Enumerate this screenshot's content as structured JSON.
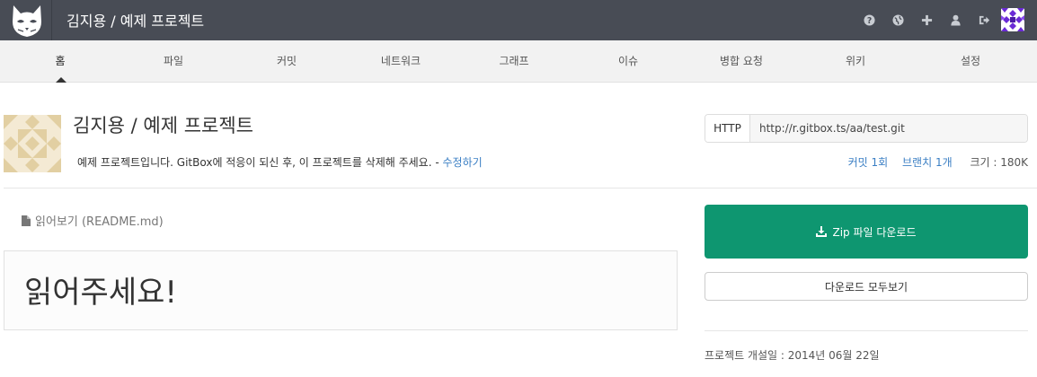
{
  "header": {
    "title": "김지용 / 예제 프로젝트",
    "logo_icon": "cat-logo-icon",
    "icons": [
      "help-icon",
      "globe-icon",
      "plus-icon",
      "user-icon",
      "sign-out-icon"
    ]
  },
  "tabs": [
    {
      "label": "홈",
      "active": true
    },
    {
      "label": "파일"
    },
    {
      "label": "커밋"
    },
    {
      "label": "네트워크"
    },
    {
      "label": "그래프"
    },
    {
      "label": "이슈"
    },
    {
      "label": "병합 요청"
    },
    {
      "label": "위키"
    },
    {
      "label": "설정"
    }
  ],
  "project": {
    "title": "김지용 / 예제 프로젝트",
    "description": "예제 프로젝트입니다. GitBox에 적응이 되신 후, 이 프로젝트를 삭제해 주세요. -",
    "edit_link": "수정하기"
  },
  "clone": {
    "protocol": "HTTP",
    "url": "http://r.gitbox.ts/aa/test.git"
  },
  "stats": {
    "commits": "커밋 1회",
    "branches": "브랜치 1개",
    "size": "크기 : 180K"
  },
  "readme": {
    "label": "읽어보기 (README.md)",
    "heading": "읽어주세요!"
  },
  "actions": {
    "zip_download": "Zip 파일 다운로드",
    "all_downloads": "다운로드 모두보기"
  },
  "meta": {
    "created": "프로젝트 개설일 : 2014년 06월 22일"
  },
  "colors": {
    "topbar": "#484c55",
    "accent_green": "#0e9670",
    "link": "#3b7fc4"
  }
}
